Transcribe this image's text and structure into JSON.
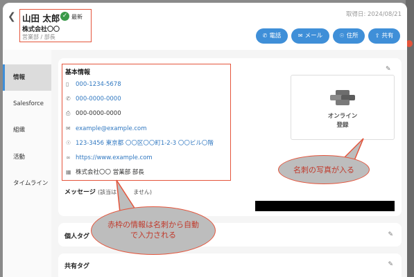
{
  "header": {
    "back_icon": "chevron-left-icon",
    "name": "山田 太郎",
    "verified_icon": "check-circle-icon",
    "latest": "最新",
    "company": "株式会社〇〇",
    "dept": "営業部 / 部長",
    "acquired": "取得日: 2024/08/21",
    "actions": [
      {
        "label": "電話",
        "icon": "phone-icon"
      },
      {
        "label": "メール",
        "icon": "mail-icon"
      },
      {
        "label": "住所",
        "icon": "location-icon"
      },
      {
        "label": "共有",
        "icon": "share-icon"
      }
    ]
  },
  "sidebar": {
    "items": [
      {
        "label": "情報",
        "active": true
      },
      {
        "label": "Salesforce"
      },
      {
        "label": "組織"
      },
      {
        "label": "活動"
      },
      {
        "label": "タイムライン"
      }
    ]
  },
  "basic": {
    "title": "基本情報",
    "rows": [
      {
        "icon": "mobile-icon",
        "text": "000-1234-5678",
        "link": true
      },
      {
        "icon": "phone-icon",
        "text": "000-0000-0000",
        "link": true
      },
      {
        "icon": "fax-icon",
        "text": "000-0000-0000",
        "link": false
      },
      {
        "icon": "mail-icon",
        "text": "example@example.com",
        "link": true
      },
      {
        "icon": "location-icon",
        "text": "123-3456 東京都 〇〇区〇〇町1-2-3 〇〇ビル〇階",
        "link": true
      },
      {
        "icon": "link-icon",
        "text": "https://www.example.com",
        "link": true
      },
      {
        "icon": "building-icon",
        "text": "株式会社〇〇 営業部 部長",
        "link": false
      }
    ]
  },
  "photo": {
    "line1": "オンライン",
    "line2": "登録"
  },
  "message": {
    "label": "メッセージ",
    "sub": "(該当は　　　ません)"
  },
  "tags": {
    "personal": "個人タグ",
    "shared": "共有タグ"
  },
  "annotations": {
    "photo_note": "名刺の写真が入る",
    "red_note_line1": "赤枠の情報は名刺から自動",
    "red_note_line2": "で入力される"
  },
  "colors": {
    "accent": "#3f8fd8",
    "annotation": "#e4543b"
  }
}
